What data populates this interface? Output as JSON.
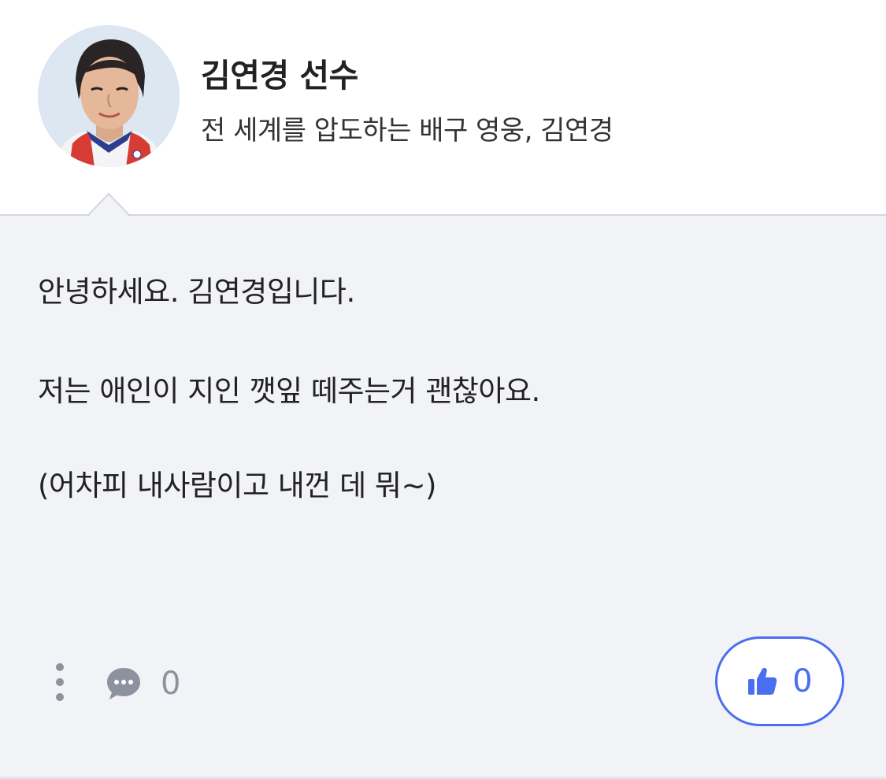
{
  "author": {
    "name": "김연경 선수",
    "description": "전 세계를 압도하는 배구 영웅, 김연경",
    "avatar_icon": "athlete-portrait"
  },
  "message": {
    "lines": [
      "안녕하세요. 김연경입니다.",
      "저는 애인이 지인 깻잎 떼주는거 괜찮아요.",
      "(어차피 내사람이고 내껀 데 뭐~)"
    ]
  },
  "actions": {
    "more_icon": "more-vertical-icon",
    "comment_icon": "comment-icon",
    "comment_count": "0",
    "like_icon": "thumbs-up-icon",
    "like_count": "0"
  },
  "colors": {
    "accent": "#4a6ef0",
    "bubble_background": "#f2f3f7",
    "muted": "#8e929e"
  }
}
